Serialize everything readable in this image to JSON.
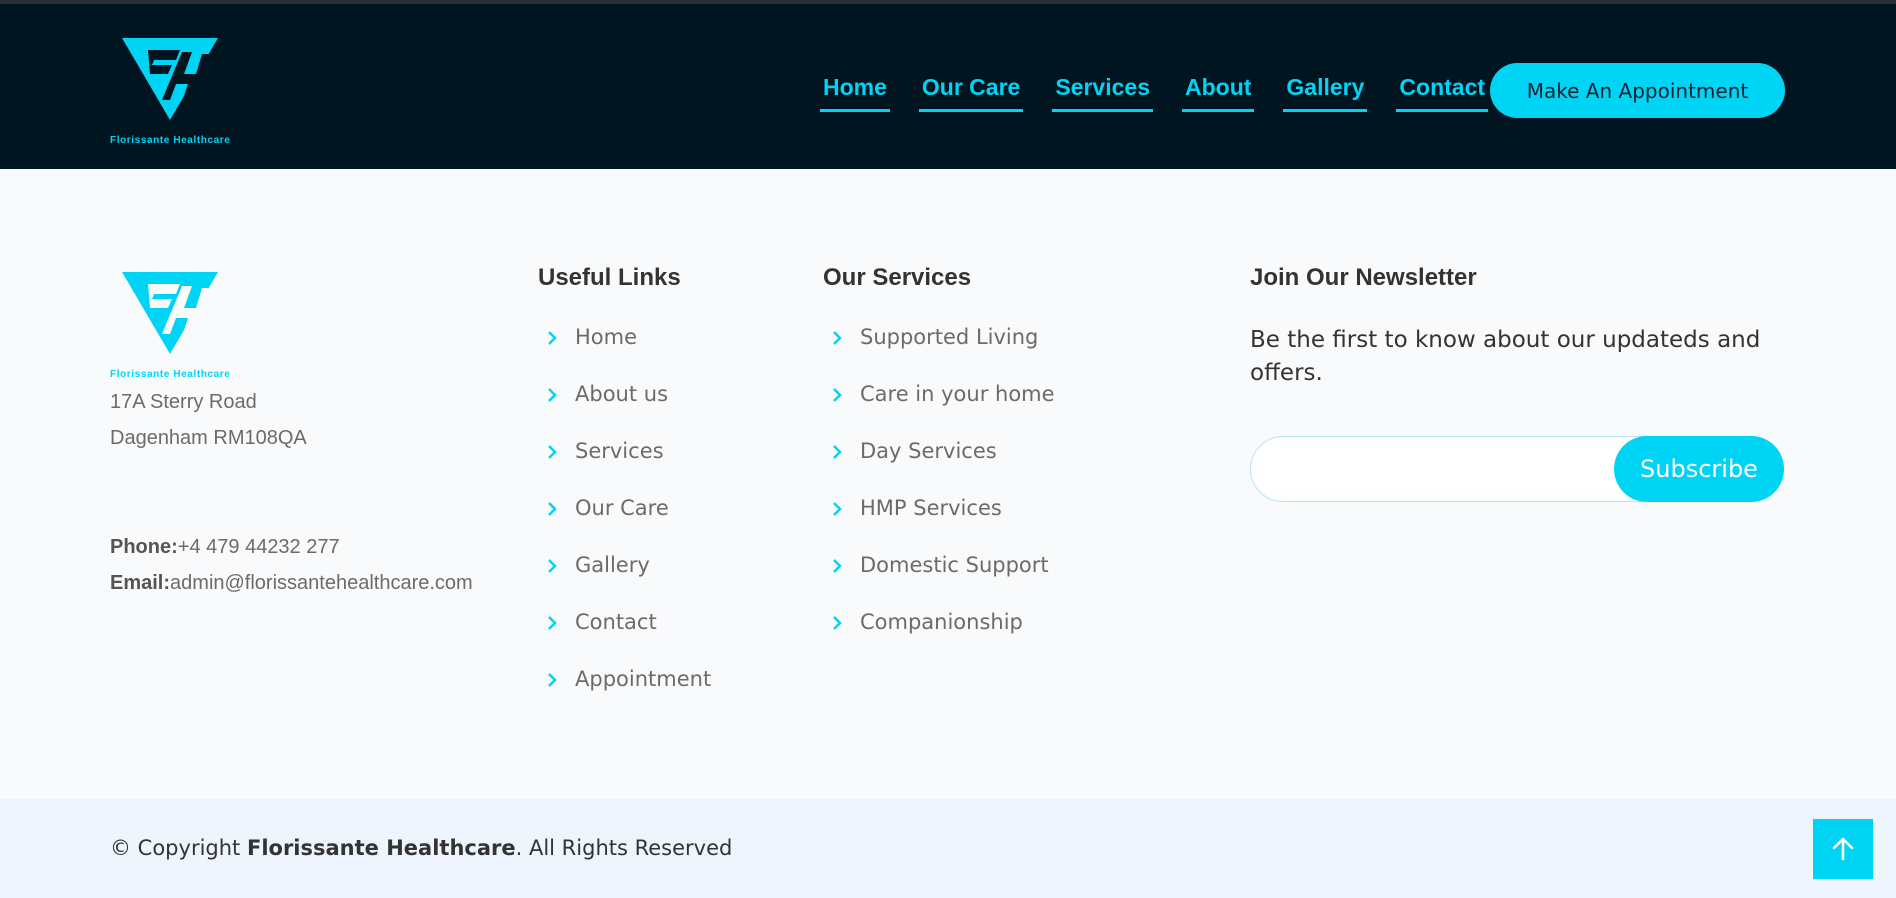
{
  "brand": {
    "name": "Florissante Healthcare",
    "logo_text": "Florissante Healthcare",
    "accent_color": "#00d4f5",
    "header_bg": "#001520"
  },
  "nav": {
    "items": [
      {
        "label": "Home"
      },
      {
        "label": "Our Care"
      },
      {
        "label": "Services"
      },
      {
        "label": "About"
      },
      {
        "label": "Gallery"
      },
      {
        "label": "Contact"
      }
    ],
    "cta_label": "Make An Appointment"
  },
  "footer": {
    "address": {
      "line1": "17A Sterry Road",
      "line2": "Dagenham RM108QA"
    },
    "phone_label": "Phone:",
    "phone": "+4 479 44232 277",
    "email_label": "Email:",
    "email": "admin@florissantehealthcare.com",
    "useful_links": {
      "title": "Useful Links",
      "items": [
        "Home",
        "About us",
        "Services",
        "Our Care",
        "Gallery",
        "Contact",
        "Appointment"
      ]
    },
    "our_services": {
      "title": "Our Services",
      "items": [
        "Supported Living",
        "Care in your home",
        "Day Services",
        "HMP Services",
        "Domestic Support",
        "Companionship"
      ]
    },
    "newsletter": {
      "title": "Join Our Newsletter",
      "text": "Be the first to know about our updateds and offers.",
      "input_value": "",
      "button_label": "Subscribe"
    }
  },
  "copyright": {
    "prefix": "© Copyright",
    "company": "Florissante Healthcare",
    "suffix": ". All Rights Reserved"
  },
  "icons": {
    "link_bullet": "chevron-right-icon",
    "back_to_top": "arrow-up-icon"
  }
}
